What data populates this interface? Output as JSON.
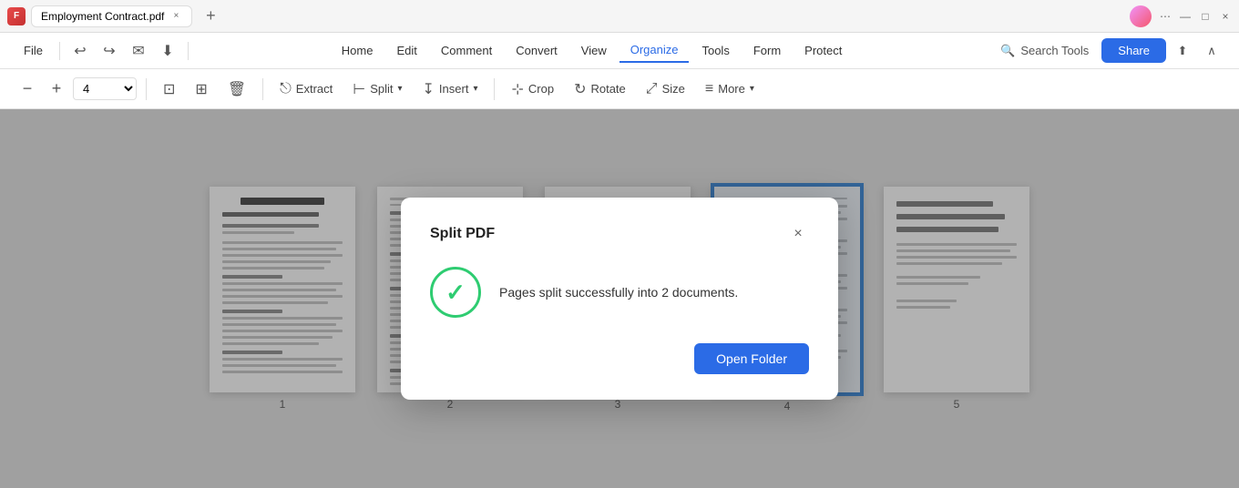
{
  "titleBar": {
    "appIcon": "F",
    "tabName": "Employment Contract.pdf",
    "tabCloseLabel": "×",
    "newTabLabel": "+",
    "moreOptionsLabel": "⋯",
    "minimizeLabel": "—",
    "maximizeLabel": "□",
    "closeLabel": "×"
  },
  "menuBar": {
    "fileLabel": "File",
    "undoLabel": "↩",
    "redoLabel": "↪",
    "emailLabel": "✉",
    "downloadLabel": "⬇",
    "navItems": [
      {
        "id": "home",
        "label": "Home"
      },
      {
        "id": "edit",
        "label": "Edit"
      },
      {
        "id": "comment",
        "label": "Comment"
      },
      {
        "id": "convert",
        "label": "Convert"
      },
      {
        "id": "view",
        "label": "View"
      },
      {
        "id": "organize",
        "label": "Organize",
        "active": true
      },
      {
        "id": "tools",
        "label": "Tools"
      },
      {
        "id": "form",
        "label": "Form"
      },
      {
        "id": "protect",
        "label": "Protect"
      }
    ],
    "searchPlaceholder": "Search Tools",
    "shareLabel": "Share",
    "uploadLabel": "⬆",
    "collapseLabel": "∧"
  },
  "toolbar": {
    "zoomOutLabel": "−",
    "zoomInLabel": "+",
    "zoomValue": "4",
    "fitPageLabel": "⊡",
    "fitWidthLabel": "⊞",
    "deleteLabel": "🗑",
    "extractLabel": "Extract",
    "splitLabel": "Split",
    "insertLabel": "Insert",
    "cropLabel": "Crop",
    "rotateLabel": "Rotate",
    "sizeLabel": "Size",
    "moreLabel": "More"
  },
  "pages": [
    {
      "num": "1",
      "selected": false,
      "hasTitle": true
    },
    {
      "num": "2",
      "selected": false,
      "hasTitle": false
    },
    {
      "num": "3",
      "selected": false,
      "hasTitle": false
    },
    {
      "num": "4",
      "selected": true,
      "hasTitle": false
    },
    {
      "num": "5",
      "selected": false,
      "hasTitle": false
    }
  ],
  "modal": {
    "title": "Split PDF",
    "closeLabel": "×",
    "message": "Pages split successfully into 2 documents.",
    "openFolderLabel": "Open Folder"
  }
}
